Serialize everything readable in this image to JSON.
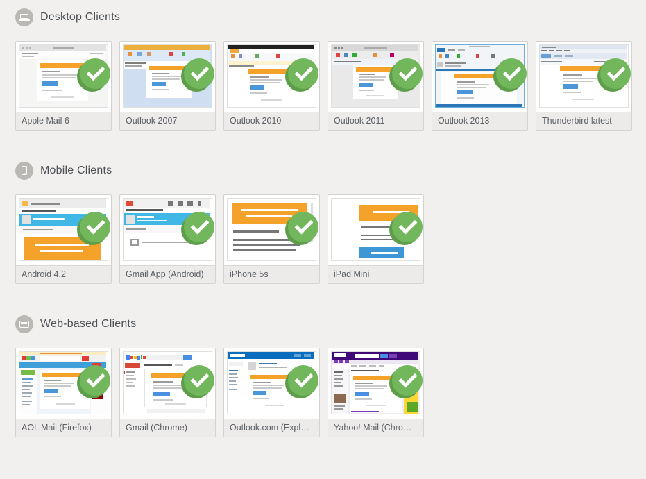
{
  "colors": {
    "page_background": "#f1f0ee",
    "badge_green": "#72b75c",
    "badge_green_shadow": "#5e9d49",
    "banner_orange": "#f5a22b",
    "button_blue": "#4a96d8"
  },
  "sections": [
    {
      "title": "Desktop Clients",
      "icon": "desktop-icon",
      "clients": [
        {
          "label": "Apple Mail 6",
          "check": true
        },
        {
          "label": "Outlook 2007",
          "check": true
        },
        {
          "label": "Outlook 2010",
          "check": true
        },
        {
          "label": "Outlook 2011",
          "check": true
        },
        {
          "label": "Outlook 2013",
          "check": true
        },
        {
          "label": "Thunderbird latest",
          "check": true
        }
      ]
    },
    {
      "title": "Mobile Clients",
      "icon": "mobile-icon",
      "clients": [
        {
          "label": "Android 4.2",
          "check": true
        },
        {
          "label": "Gmail App (Android)",
          "check": true
        },
        {
          "label": "iPhone 5s",
          "check": true
        },
        {
          "label": "iPad Mini",
          "check": true
        }
      ]
    },
    {
      "title": "Web-based Clients",
      "icon": "webmail-icon",
      "clients": [
        {
          "label": "AOL Mail (Firefox)",
          "check": true
        },
        {
          "label": "Gmail (Chrome)",
          "check": true
        },
        {
          "label": "Outlook.com (Explorer)",
          "check": true
        },
        {
          "label": "Yahoo! Mail (Chrome)",
          "check": true
        }
      ]
    }
  ]
}
